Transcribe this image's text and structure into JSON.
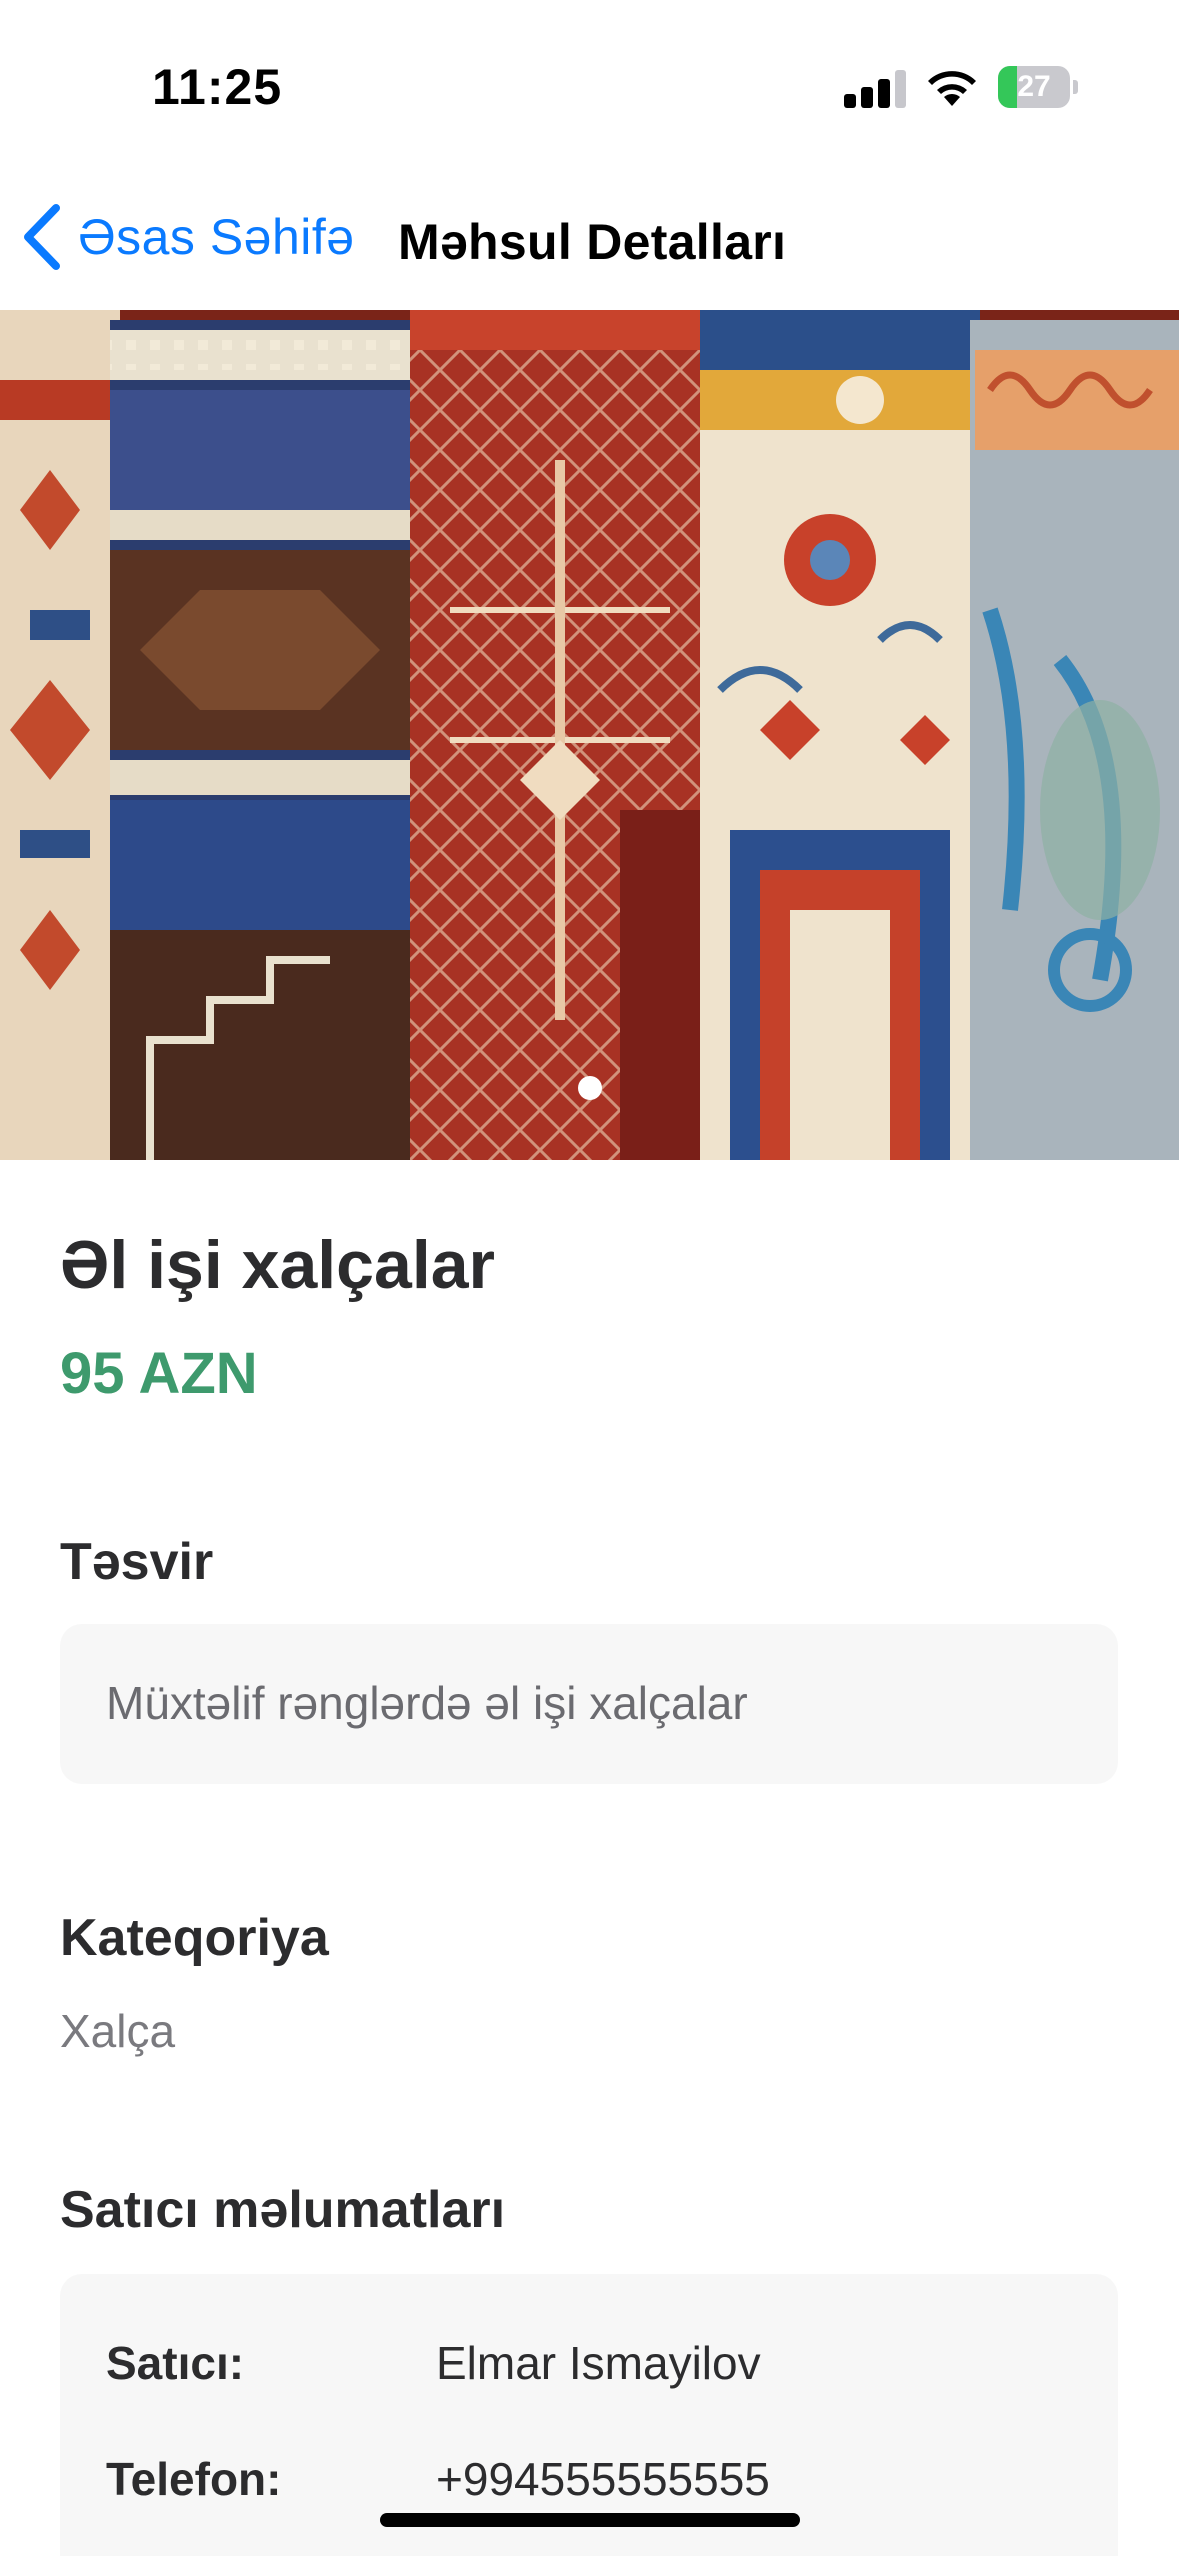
{
  "status_bar": {
    "time": "11:25",
    "battery_percent": "27",
    "battery_level": 0.27,
    "signal_bars_active": 3,
    "signal_bars_total": 4
  },
  "nav": {
    "back_label": "Əsas Səhifə",
    "title": "Məhsul Detalları"
  },
  "carousel": {
    "image_subject": "rolled handmade carpets",
    "page_count": 1,
    "current_page": 1
  },
  "product": {
    "title": "Əl işi xalçalar",
    "price": "95 AZN"
  },
  "description": {
    "heading": "Təsvir",
    "text": "Müxtəlif rənglərdə əl işi xalçalar"
  },
  "category": {
    "heading": "Kateqoriya",
    "value": "Xalça"
  },
  "seller": {
    "heading": "Satıcı məlumatları",
    "rows": [
      {
        "key": "Satıcı:",
        "value": "Elmar Ismayilov"
      },
      {
        "key": "Telefon:",
        "value": "+994555555555"
      }
    ]
  },
  "colors": {
    "accent": "#0a7aff",
    "price": "#3e9a6d",
    "battery": "#34c759"
  }
}
